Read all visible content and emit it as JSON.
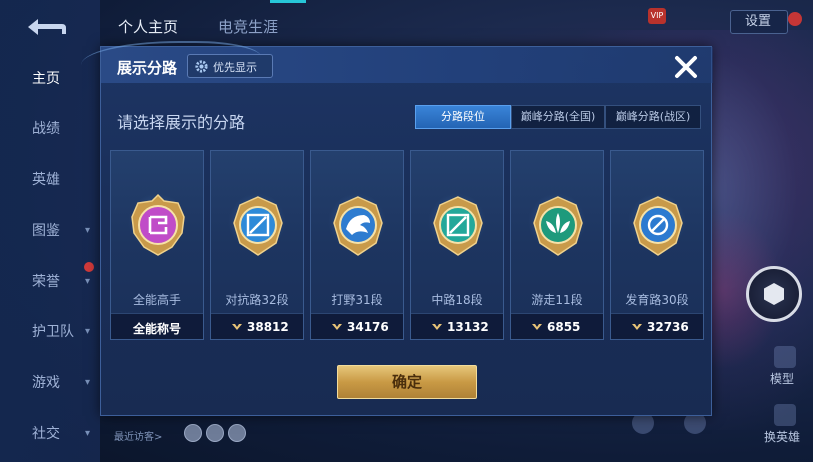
{
  "sidebar": {
    "items": [
      {
        "label": "主页",
        "active": true
      },
      {
        "label": "战绩"
      },
      {
        "label": "英雄"
      },
      {
        "label": "图鉴"
      },
      {
        "label": "荣誉"
      },
      {
        "label": "护卫队"
      },
      {
        "label": "游戏"
      },
      {
        "label": "社交"
      }
    ]
  },
  "header": {
    "tabs": [
      {
        "label": "个人主页",
        "active": true
      },
      {
        "label": "电竞生涯"
      }
    ],
    "settings_label": "设置",
    "vip_label": "VIP"
  },
  "modal": {
    "title": "展示分路",
    "priority_label": "优先显示",
    "subtitle": "请选择展示的分路",
    "segments": [
      {
        "label": "分路段位",
        "active": true
      },
      {
        "label": "巅峰分路(全国)"
      },
      {
        "label": "巅峰分路(战区)"
      }
    ],
    "cards": [
      {
        "name": "全能高手",
        "footer": "全能称号",
        "color": "#c04cc8",
        "icon": "all-round-emblem-icon"
      },
      {
        "name": "对抗路32段",
        "value": "38812",
        "color": "#2e8ad8",
        "icon": "clash-lane-emblem-icon"
      },
      {
        "name": "打野31段",
        "value": "34176",
        "color": "#2e7cd0",
        "icon": "jungle-emblem-icon"
      },
      {
        "name": "中路18段",
        "value": "13132",
        "color": "#23a89a",
        "icon": "mid-lane-emblem-icon"
      },
      {
        "name": "游走11段",
        "value": "6855",
        "color": "#1e9a7c",
        "icon": "roam-emblem-icon"
      },
      {
        "name": "发育路30段",
        "value": "32736",
        "color": "#2c7ad0",
        "icon": "farm-lane-emblem-icon"
      }
    ],
    "confirm_label": "确定"
  },
  "right_panel": {
    "model_label": "模型",
    "hero_label": "换英雄"
  },
  "bottom": {
    "recent_visitors_label": "最近访客>"
  },
  "colors": {
    "accent_blue": "#2464b4",
    "gold": "#c99a45",
    "panel": "#1a2f5a"
  }
}
